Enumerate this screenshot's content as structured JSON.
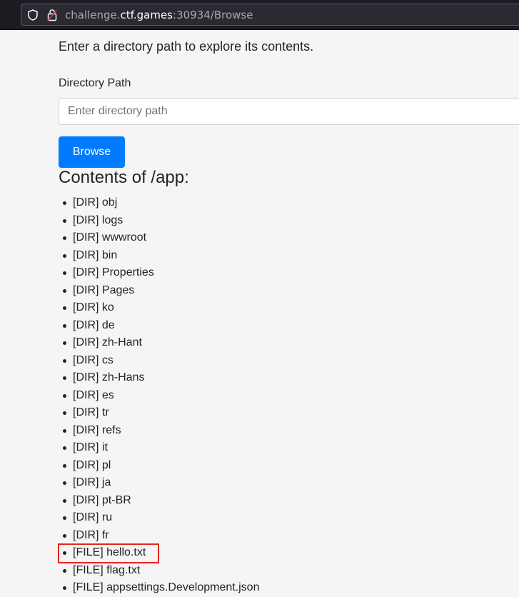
{
  "browser": {
    "url_prefix": "challenge.",
    "url_host": "ctf.games",
    "url_suffix": ":30934/Browse"
  },
  "page": {
    "intro": "Enter a directory path to explore its contents.",
    "field_label": "Directory Path",
    "input_placeholder": "Enter directory path",
    "input_value": "",
    "browse_label": "Browse",
    "contents_heading": "Contents of /app:"
  },
  "entries": [
    "[DIR] obj",
    "[DIR] logs",
    "[DIR] wwwroot",
    "[DIR] bin",
    "[DIR] Properties",
    "[DIR] Pages",
    "[DIR] ko",
    "[DIR] de",
    "[DIR] zh-Hant",
    "[DIR] cs",
    "[DIR] zh-Hans",
    "[DIR] es",
    "[DIR] tr",
    "[DIR] refs",
    "[DIR] it",
    "[DIR] pl",
    "[DIR] ja",
    "[DIR] pt-BR",
    "[DIR] ru",
    "[DIR] fr",
    "[FILE] hello.txt",
    "[FILE] flag.txt",
    "[FILE] appsettings.Development.json"
  ],
  "colors": {
    "accent": "#007bff",
    "highlight": "#e8231e"
  }
}
